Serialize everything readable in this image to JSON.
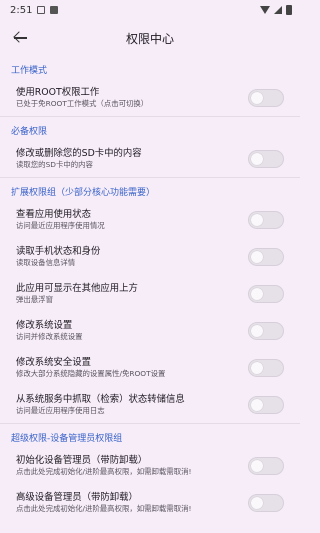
{
  "status_bar": {
    "time": "2:51"
  },
  "app_bar": {
    "title": "权限中心"
  },
  "sections": [
    {
      "header": "工作模式",
      "items": [
        {
          "title": "使用ROOT权限工作",
          "subtitle": "已处于免ROOT工作模式（点击可切换）",
          "enabled": false
        }
      ]
    },
    {
      "header": "必备权限",
      "items": [
        {
          "title": "修改或删除您的SD卡中的内容",
          "subtitle": "读取您的SD卡中的内容",
          "enabled": false
        }
      ]
    },
    {
      "header": "扩展权限组（少部分核心功能需要）",
      "items": [
        {
          "title": "查看应用使用状态",
          "subtitle": "访问最近应用程序使用情况",
          "enabled": false
        },
        {
          "title": "读取手机状态和身份",
          "subtitle": "读取设备信息详情",
          "enabled": false
        },
        {
          "title": "此应用可显示在其他应用上方",
          "subtitle": "弹出悬浮窗",
          "enabled": false
        },
        {
          "title": "修改系统设置",
          "subtitle": "访问并修改系统设置",
          "enabled": false
        },
        {
          "title": "修改系统安全设置",
          "subtitle": "修改大部分系统隐藏的设置属性/免ROOT设置",
          "enabled": false
        },
        {
          "title": "从系统服务中抓取（检索）状态转储信息",
          "subtitle": "访问最近应用程序使用日志",
          "enabled": false
        }
      ]
    },
    {
      "header": "超级权限-设备管理员权限组",
      "items": [
        {
          "title": "初始化设备管理员（带防卸载）",
          "subtitle": "点击此处完成初始化/进阶最高权限，如需卸载需取消!",
          "enabled": false
        },
        {
          "title": "高级设备管理员（带防卸载）",
          "subtitle": "点击此处完成初始化/进阶最高权限，如需卸载需取消!",
          "enabled": false
        }
      ]
    }
  ]
}
